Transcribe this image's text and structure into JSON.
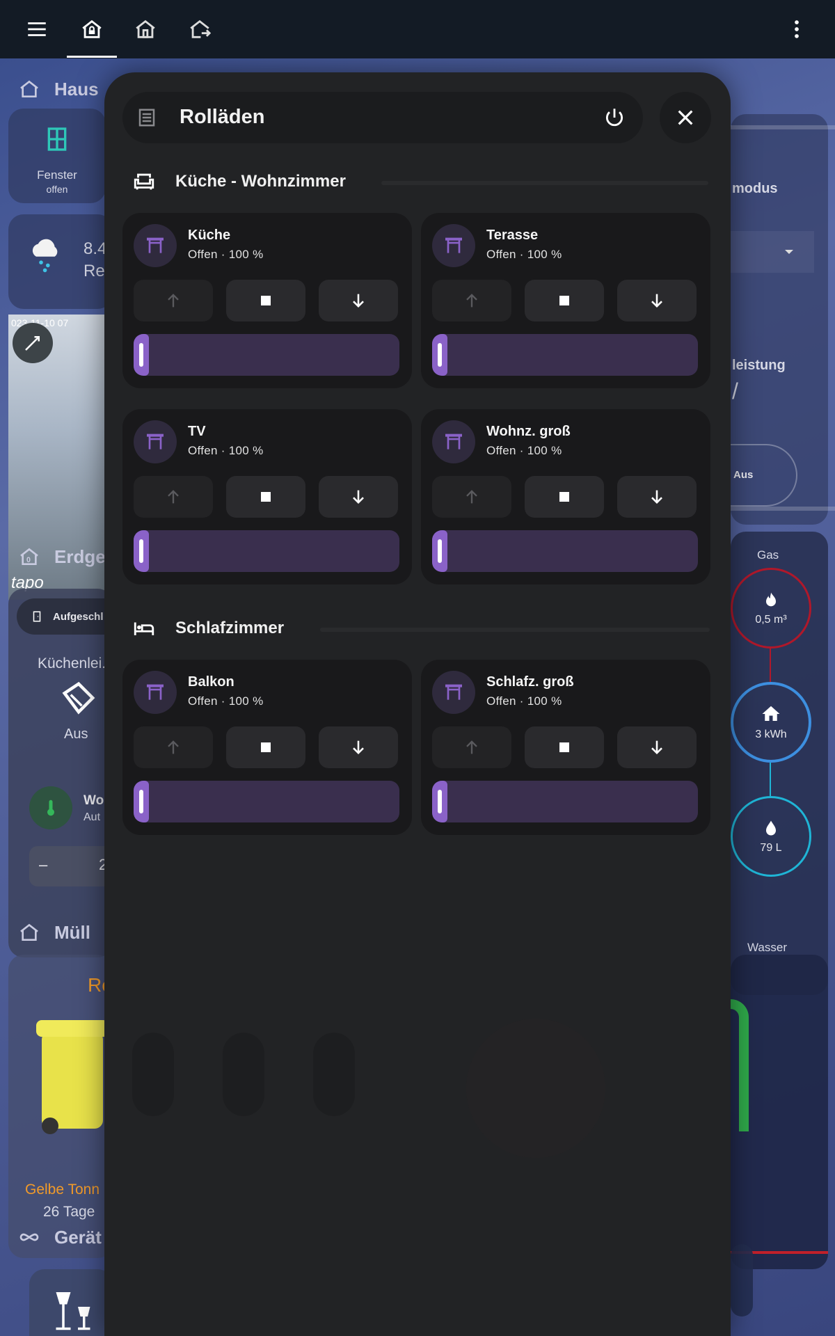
{
  "topbar": {
    "icons": [
      "menu-icon",
      "home-lock-icon",
      "home-outline-icon",
      "home-export-icon",
      "dots-vertical-icon"
    ]
  },
  "background": {
    "haus_title": "Haus",
    "fenster_label": "Fenster",
    "fenster_state": "offen",
    "weather_temp": "8.4",
    "weather_desc": "Re",
    "camera_timestamp": "023-11-10 07",
    "camera_brand": "tapo",
    "erdgeschoss_title": "Erdge",
    "door_chip": "Aufgeschl",
    "kitchen_light_label": "Küchenlei.",
    "kitchen_light_state": "Aus",
    "thermostat_name": "Wo",
    "thermostat_mode": "Aut",
    "stepper_minus": "–",
    "stepper_value": "2",
    "muell_title": "Müll",
    "muell_next": "Re",
    "bin_name": "Gelbe Tonn",
    "bin_days": "26 Tage",
    "geraete_title": "Gerät",
    "right_mode": "modus",
    "right_power": "leistung",
    "right_power_value": "/",
    "right_aus": "Aus",
    "gas_label": "Gas",
    "gas_value": "0,5 m³",
    "home_value": "3 kWh",
    "water_value": "79 L",
    "water_label": "Wasser"
  },
  "dialog": {
    "title": "Rolläden",
    "sections": [
      {
        "title": "Küche - Wohnzimmer"
      },
      {
        "title": "Schlafzimmer"
      }
    ],
    "covers": [
      {
        "name": "Küche",
        "status": "Offen · 100 %",
        "position": 1.0
      },
      {
        "name": "Terasse",
        "status": "Offen · 100 %",
        "position": 1.0
      },
      {
        "name": "TV",
        "status": "Offen · 100 %",
        "position": 1.0
      },
      {
        "name": "Wohnz. groß",
        "status": "Offen · 100 %",
        "position": 1.0
      },
      {
        "name": "Balkon",
        "status": "Offen · 100 %",
        "position": 1.0
      },
      {
        "name": "Schlafz. groß",
        "status": "Offen · 100 %",
        "position": 1.0
      }
    ]
  },
  "colors": {
    "accent": "#8a62c8",
    "slider_track": "#3a2f4e",
    "card": "#19191b",
    "dialog": "#222325",
    "gas": "#b0182a",
    "home": "#3d8fe0",
    "water": "#1fb5d6"
  }
}
